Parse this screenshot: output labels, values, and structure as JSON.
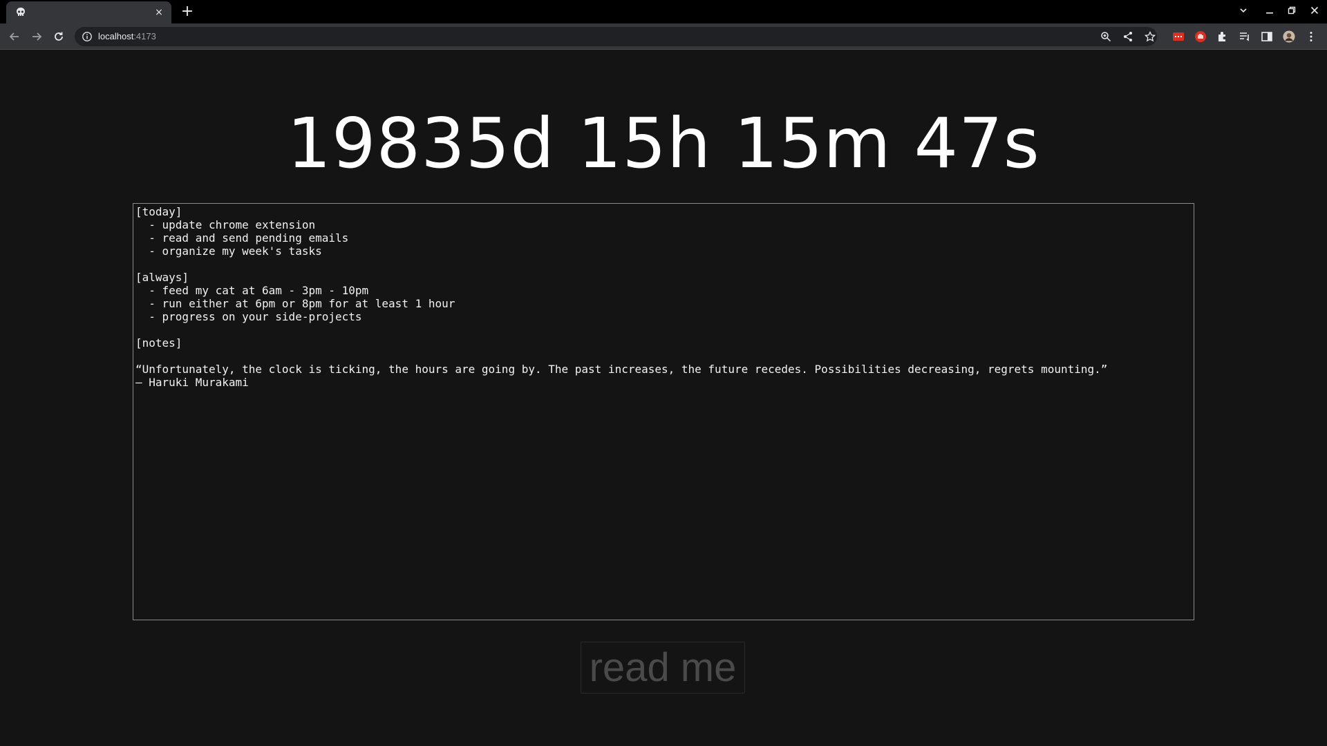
{
  "browser": {
    "tab_favicon": "skull-icon",
    "tab_close": "×",
    "new_tab": "+",
    "url_host": "localhost",
    "url_port": ":4173"
  },
  "page": {
    "countdown": "19835d 15h 15m 47s",
    "notes_text": "[today]\n  - update chrome extension\n  - read and send pending emails\n  - organize my week's tasks\n\n[always]\n  - feed my cat at 6am - 3pm - 10pm\n  - run either at 6pm or 8pm for at least 1 hour\n  - progress on your side-projects\n\n[notes]\n\n“Unfortunately, the clock is ticking, the hours are going by. The past increases, the future recedes. Possibilities decreasing, regrets mounting.”\n— Haruki Murakami",
    "readme_label": "read me"
  },
  "colors": {
    "background": "#141414",
    "text": "#ffffff",
    "textarea_border": "#8a8a8a",
    "readme_text": "#4a4a4a"
  }
}
